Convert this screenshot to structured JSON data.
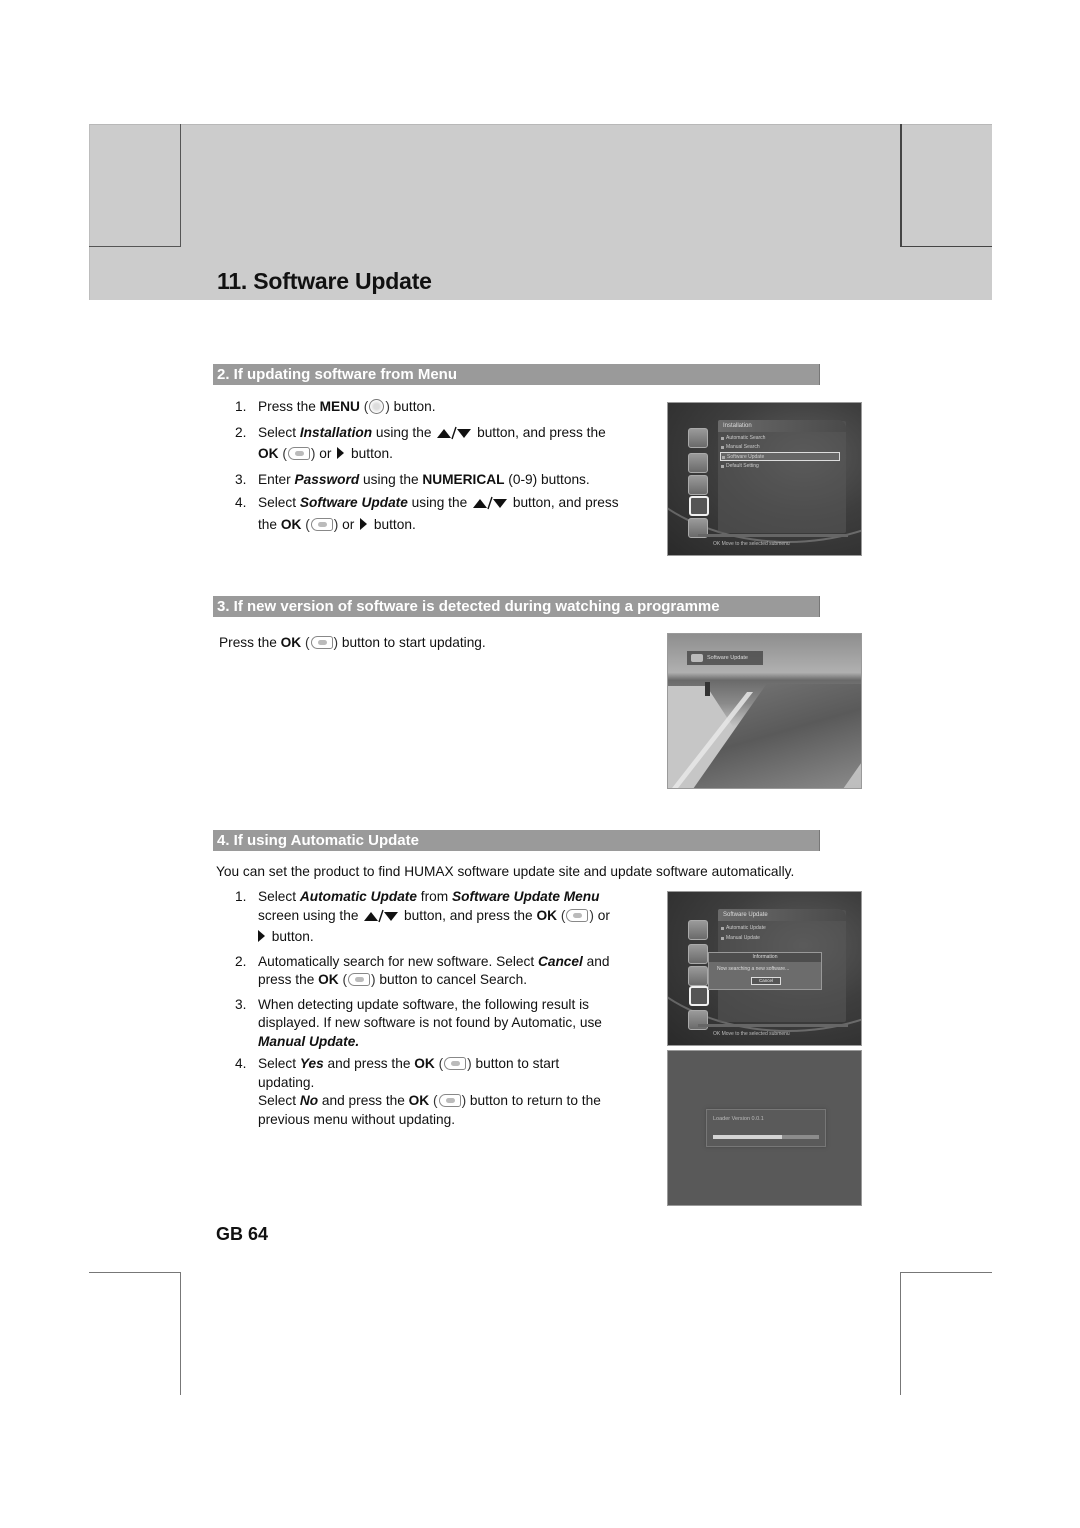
{
  "page": {
    "title": "11. Software Update",
    "page_number": "GB 64"
  },
  "icons": {
    "menu_button": "menu-remote-button-icon",
    "ok_button": "ok-remote-button-icon",
    "up_down": "▲/▼",
    "right_arrow": "right-triangle-icon"
  },
  "section2": {
    "heading": "2. If updating software from Menu",
    "steps": [
      {
        "num": "1.",
        "a": "Press the ",
        "b": "MENU",
        "c": " button."
      },
      {
        "num": "2.",
        "a": "Select ",
        "bi": "Installation",
        "c": " using the ",
        "d": " button, and press the",
        "ok": "OK",
        "e": " or ",
        "f": " button."
      },
      {
        "num": "3.",
        "a": "Enter ",
        "bi": "Password",
        "c": " using the ",
        "b": "NUMERICAL",
        "d": " (0-9) buttons."
      },
      {
        "num": "4.",
        "a": "Select ",
        "bi": "Software Update",
        "c": " using the ",
        "d": " button, and press",
        "e": "the ",
        "ok": "OK",
        "f": " or ",
        "g": " button."
      }
    ],
    "screen": {
      "menu_title": "Installation",
      "items": [
        "Automatic Search",
        "Manual Search",
        "Software Update",
        "Default Setting"
      ],
      "selected_item": "Software Update",
      "help_text": "OK  Move to the selected submenu"
    }
  },
  "section3": {
    "heading": "3. If new version of software is detected during watching a programme",
    "text_a": "Press the ",
    "text_ok": "OK",
    "text_b": " button to start updating.",
    "screen": {
      "osd_label": "Software Update"
    }
  },
  "section4": {
    "heading": "4. If using Automatic Update",
    "intro": "You can set the product to find HUMAX software update site and update software automatically.",
    "steps": [
      {
        "num": "1.",
        "a": "Select ",
        "bi1": "Automatic Update",
        "b": " from ",
        "bi2": "Software Update Menu",
        "c": "screen using the ",
        "d": " button, and press the ",
        "ok": "OK",
        "e": " or",
        "f": " button."
      },
      {
        "num": "2.",
        "a": "Automatically search for new software. Select ",
        "bi": "Cancel",
        "b": " and",
        "c": "press the ",
        "ok": "OK",
        "d": " button to cancel Search."
      },
      {
        "num": "3.",
        "a": "When detecting update software, the following result is displayed. If new software is not found by Automatic, use ",
        "bi": "Manual Update."
      },
      {
        "num": "4.",
        "a": "Select ",
        "bi": "Yes",
        "b": " and press the ",
        "ok": "OK",
        "c": " button to start updating.",
        "d": "Select ",
        "bi2": "No",
        "e": " and press the ",
        "ok2": "OK",
        "f": " button to return to the previous menu without updating."
      }
    ],
    "screen_search": {
      "menu_title": "Software Update",
      "items": [
        "Automatic Update",
        "Manual Update"
      ],
      "popup_title": "Information",
      "popup_message": "Now searching a new software...",
      "popup_button": "Cancel",
      "help_text": "OK  Move to the selected submenu"
    },
    "screen_loader": {
      "label": "Loader Version 0.0.1",
      "progress_percent": 65
    }
  }
}
